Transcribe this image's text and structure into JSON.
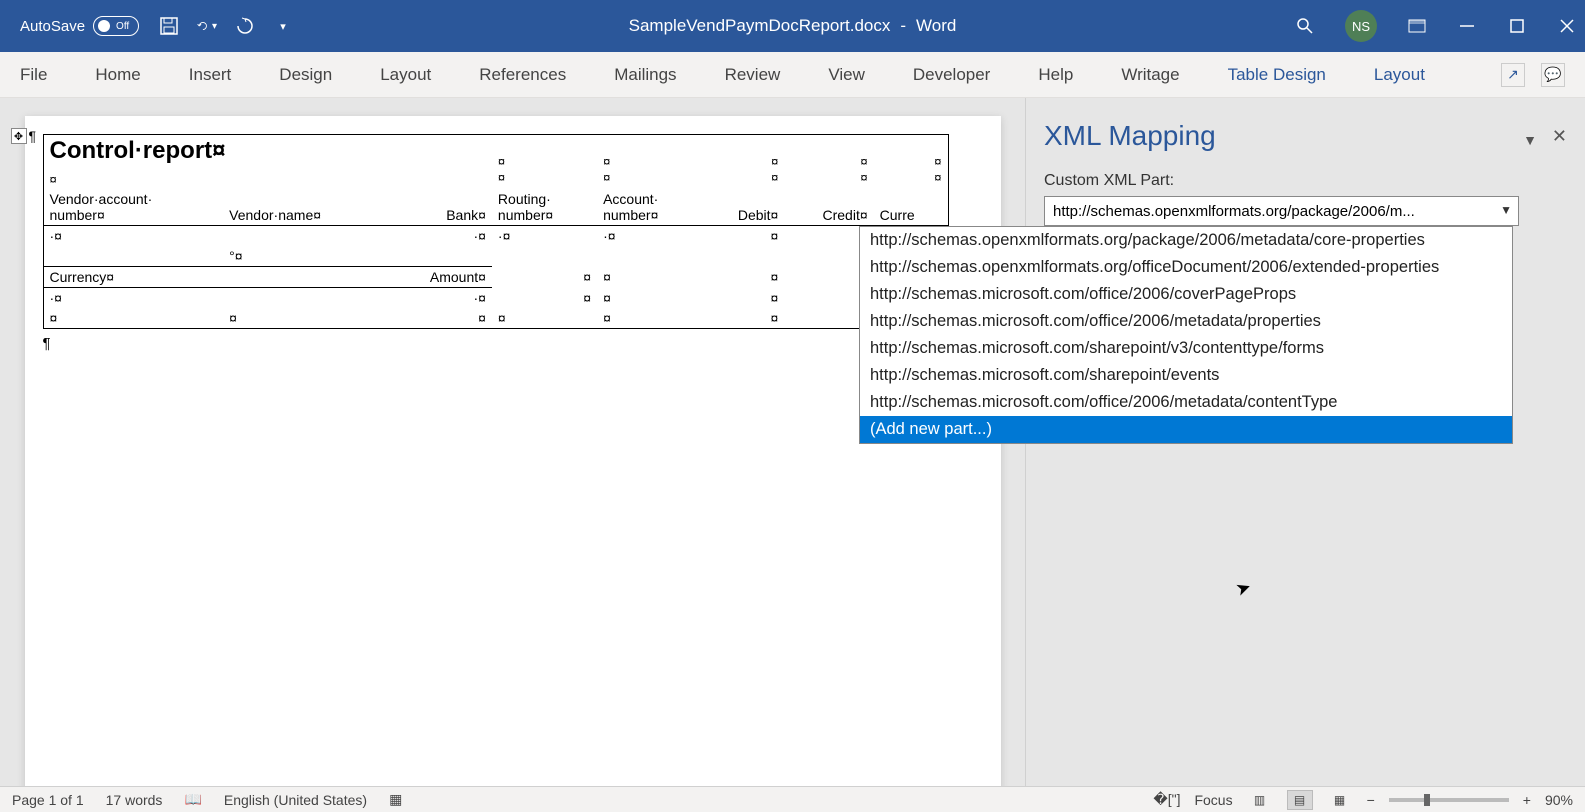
{
  "titlebar": {
    "autosave_label": "AutoSave",
    "autosave_state": "Off",
    "doc_name": "SampleVendPaymDocReport.docx",
    "app_name": "Word",
    "user_initials": "NS"
  },
  "ribbon": {
    "tabs": [
      "File",
      "Home",
      "Insert",
      "Design",
      "Layout",
      "References",
      "Mailings",
      "Review",
      "View",
      "Developer",
      "Help",
      "Writage",
      "Table Design",
      "Layout"
    ],
    "active_tabs": [
      "Table Design",
      "Layout"
    ]
  },
  "document": {
    "title": "Control·report¤",
    "headers_row1": [
      "Vendor·account·",
      "",
      "",
      "Routing·",
      "Account·",
      "",
      "",
      ""
    ],
    "headers_row2": [
      "number¤",
      "Vendor·name¤",
      "Bank¤",
      "number¤",
      "number¤",
      "Debit¤",
      "Credit¤",
      "Curre"
    ],
    "sub_headers": [
      "Currency¤",
      "",
      "Amount¤",
      "",
      "",
      "",
      "",
      ""
    ]
  },
  "panel": {
    "title": "XML Mapping",
    "label": "Custom XML Part:",
    "combo_value": "http://schemas.openxmlformats.org/package/2006/m...",
    "options": [
      "http://schemas.openxmlformats.org/package/2006/metadata/core-properties",
      "http://schemas.openxmlformats.org/officeDocument/2006/extended-properties",
      "http://schemas.microsoft.com/office/2006/coverPageProps",
      "http://schemas.microsoft.com/office/2006/metadata/properties",
      "http://schemas.microsoft.com/sharepoint/v3/contenttype/forms",
      "http://schemas.microsoft.com/sharepoint/events",
      "http://schemas.microsoft.com/office/2006/metadata/contentType",
      "(Add new part...)"
    ],
    "selected_index": 7
  },
  "statusbar": {
    "page": "Page 1 of 1",
    "words": "17 words",
    "language": "English (United States)",
    "focus": "Focus",
    "zoom": "90%"
  }
}
